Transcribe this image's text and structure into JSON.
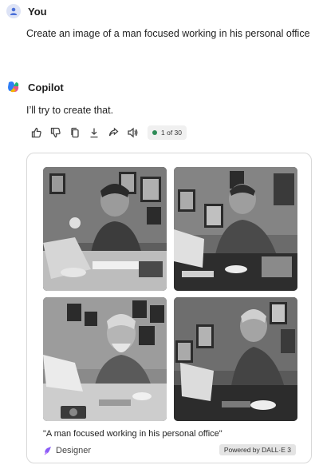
{
  "user": {
    "name": "You",
    "message": "Create an image of a man focused working in his personal office"
  },
  "assistant": {
    "name": "Copilot",
    "message": "I’ll try to create that.",
    "actions": [
      "thumbs-up-icon",
      "thumbs-down-icon",
      "copy-icon",
      "download-icon",
      "share-icon",
      "read-aloud-icon"
    ],
    "page_counter": "1 of 30"
  },
  "result": {
    "images": [
      {
        "label": "generated-image-1"
      },
      {
        "label": "generated-image-2"
      },
      {
        "label": "generated-image-3"
      },
      {
        "label": "generated-image-4"
      }
    ],
    "caption": "\"A man focused working in his personal office\"",
    "source": "Designer",
    "badge": "Powered by DALL·E 3"
  },
  "colors": {
    "accent": "#2e8b57",
    "user_avatar": "#4a6fd8"
  }
}
